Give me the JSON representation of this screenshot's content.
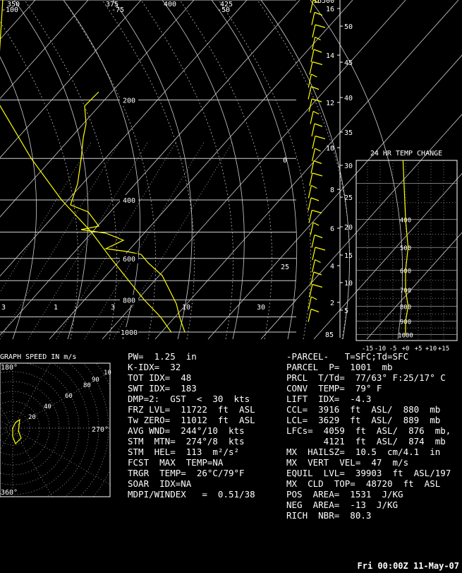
{
  "skewt": {
    "isobars": [
      200,
      400,
      600,
      800,
      1000
    ],
    "top_temp_labels": [
      "-100",
      "-75",
      "-50"
    ],
    "top_theta_labels": [
      "350",
      "375",
      "400",
      "425"
    ],
    "isotherm_labels": [
      "0",
      "25",
      "30",
      "10",
      "3",
      "1",
      "3"
    ]
  },
  "height_scale": {
    "km": [
      "16",
      "14",
      "12",
      "10",
      "8",
      "6",
      "4",
      "2"
    ],
    "kft": [
      "50",
      "45",
      "40",
      "35",
      "30",
      "25",
      "20",
      "15",
      "10",
      "5"
    ],
    "top_label": "16500",
    "bottom_label": "85"
  },
  "temp_change": {
    "title": "24 HR TEMP CHANGE",
    "x_labels": [
      "-15",
      "-10",
      "-5",
      "+0",
      "+5",
      "+10",
      "+15"
    ],
    "p_labels": [
      "400",
      "500",
      "600",
      "700",
      "800",
      "900",
      "1000"
    ]
  },
  "hodograph": {
    "title": "GRAPH SPEED IN m/s",
    "rings": [
      "20",
      "40",
      "60",
      "80",
      "90",
      "10"
    ],
    "dir_labels": [
      "180°",
      "270°",
      "360°"
    ]
  },
  "indices": {
    "lines": [
      "PW=  1.25  in",
      "K-IDX=  32",
      "TOT IDX=  48",
      "SWT IDX=  183",
      "DMP=2:  GST  <  30  kts",
      "FRZ LVL=  11722  ft  ASL",
      "Tw ZERO=  11012  ft  ASL",
      "AVG WND=  244°/10  kts",
      "STM  MTN=  274°/8  kts",
      "STM  HEL=  113  m²/s²",
      "FCST  MAX  TEMP=NA",
      "TRGR  TEMP=  26°C/79°F",
      "SOAR  IDX=NA",
      "MDPI/WINDEX   =  0.51/38"
    ]
  },
  "parcel": {
    "lines": [
      "-PARCEL-   T=SFC;Td=SFC",
      "PARCEL  P=  1001  mb",
      "PRCL  T/Td=  77/63° F:25/17° C",
      "CONV  TEMP=  79° F",
      "LIFT  IDX=  -4.3",
      "CCL=  3916  ft  ASL/  880  mb",
      "LCL=  3629  ft  ASL/  889  mb",
      "LFCs=  4059  ft  ASL/  876  mb,",
      "       4121  ft  ASL/  874  mb",
      "MX  HAILSZ=  10.5  cm/4.1  in",
      "MX  VERT  VEL=  47  m/s",
      "EQUIL  LVL=  39903  ft  ASL/197  mb",
      "MX  CLD  TOP=  48720  ft  ASL",
      "POS  AREA=  1531  J/KG",
      "NEG  AREA=  -13  J/KG",
      "RICH  NBR=  80.3"
    ]
  },
  "footer": "Fri 00:00Z 11-May-07",
  "colors": {
    "background": "#000000",
    "text": "#ffffff",
    "sounding": "#ffff00",
    "grid": "#cfcfcf",
    "dashed": "#bfbfbf"
  },
  "chart_data": {
    "type": "line",
    "title": "",
    "temperature_trace_mb": [
      {
        "p": 100,
        "t": -62
      },
      {
        "p": 200,
        "t": -55
      },
      {
        "p": 300,
        "t": -38
      },
      {
        "p": 400,
        "t": -24
      },
      {
        "p": 500,
        "t": -11
      },
      {
        "p": 600,
        "t": -2
      },
      {
        "p": 700,
        "t": 6
      },
      {
        "p": 800,
        "t": 13
      },
      {
        "p": 900,
        "t": 20
      },
      {
        "p": 1000,
        "t": 25
      }
    ],
    "temp_change_trace": [
      {
        "p": 250,
        "dt": -1
      },
      {
        "p": 400,
        "dt": 0
      },
      {
        "p": 500,
        "dt": 1
      },
      {
        "p": 600,
        "dt": 0
      },
      {
        "p": 700,
        "dt": 0
      },
      {
        "p": 800,
        "dt": 1
      },
      {
        "p": 900,
        "dt": 0
      },
      {
        "p": 1000,
        "dt": 0
      }
    ]
  }
}
